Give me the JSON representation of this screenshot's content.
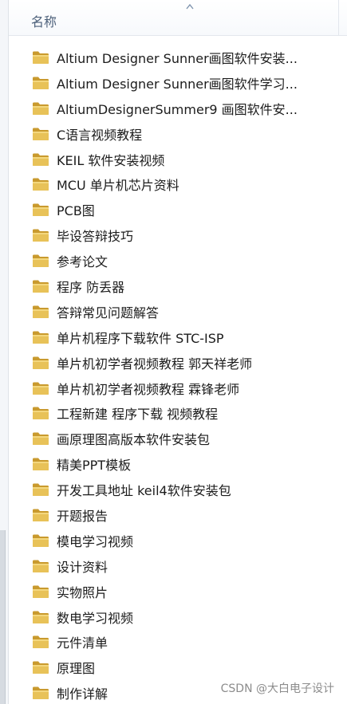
{
  "column_header": {
    "name_label": "名称"
  },
  "files": [
    {
      "name": "Altium Designer Sunner画图软件安装..."
    },
    {
      "name": "Altium Designer Sunner画图软件学习..."
    },
    {
      "name": "AltiumDesignerSummer9 画图软件安..."
    },
    {
      "name": "C语言视频教程"
    },
    {
      "name": "KEIL 软件安装视频"
    },
    {
      "name": "MCU 单片机芯片资料"
    },
    {
      "name": "PCB图"
    },
    {
      "name": "毕设答辩技巧"
    },
    {
      "name": "参考论文"
    },
    {
      "name": "程序 防丢器"
    },
    {
      "name": "答辩常见问题解答"
    },
    {
      "name": "单片机程序下载软件 STC-ISP"
    },
    {
      "name": "单片机初学者视频教程 郭天祥老师"
    },
    {
      "name": "单片机初学者视频教程 霖锋老师"
    },
    {
      "name": "工程新建  程序下载 视频教程"
    },
    {
      "name": "画原理图高版本软件安装包"
    },
    {
      "name": "精美PPT模板"
    },
    {
      "name": "开发工具地址 keil4软件安装包"
    },
    {
      "name": "开题报告"
    },
    {
      "name": "模电学习视频"
    },
    {
      "name": "设计资料"
    },
    {
      "name": "实物照片"
    },
    {
      "name": "数电学习视频"
    },
    {
      "name": "元件清单"
    },
    {
      "name": "原理图"
    },
    {
      "name": "制作详解"
    }
  ],
  "watermark": "CSDN @大白电子设计",
  "icon": "folder-icon",
  "colors": {
    "folder_body": "#e8c258",
    "folder_dark": "#c99a2e",
    "header_text": "#4c607a"
  }
}
